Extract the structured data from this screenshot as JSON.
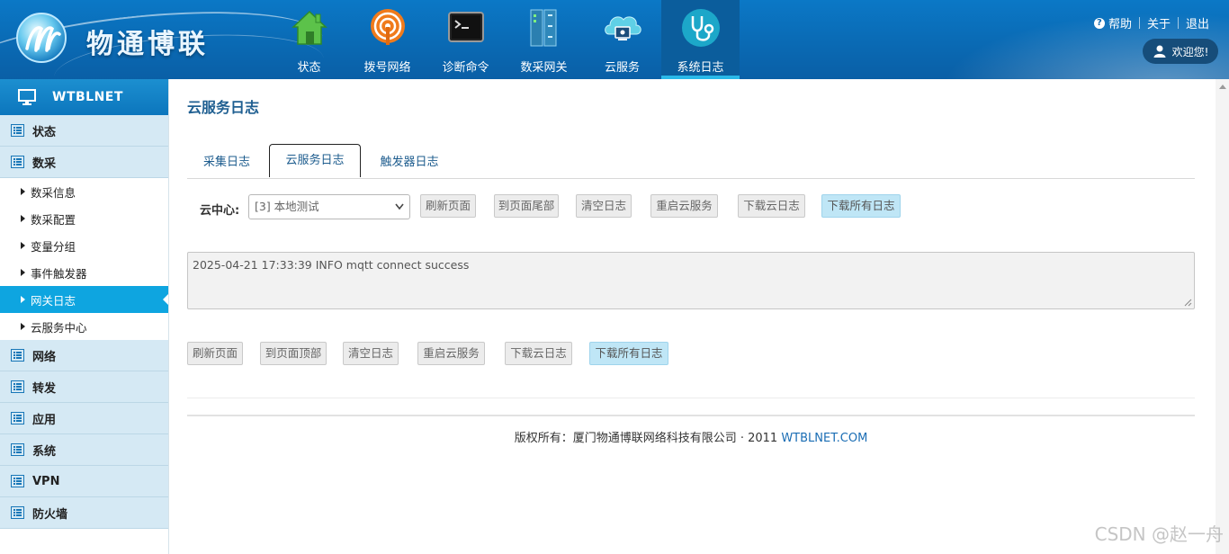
{
  "header": {
    "logo_text": "物通博联",
    "nav": [
      {
        "label": "状态",
        "icon": "home-icon"
      },
      {
        "label": "拨号网络",
        "icon": "dial-network-icon"
      },
      {
        "label": "诊断命令",
        "icon": "terminal-icon"
      },
      {
        "label": "数采网关",
        "icon": "gateway-icon"
      },
      {
        "label": "云服务",
        "icon": "cloud-service-icon"
      },
      {
        "label": "系统日志",
        "icon": "stethoscope-icon",
        "active": true
      }
    ],
    "help": "帮助",
    "about": "关于",
    "logout": "退出",
    "welcome": "欢迎您!"
  },
  "sidebar": {
    "brand": "WTBLNET",
    "sections": {
      "status": "状态",
      "data_acquisition": "数采",
      "network": "网络",
      "forward": "转发",
      "application": "应用",
      "system": "系统",
      "vpn": "VPN",
      "firewall": "防火墙"
    },
    "sub_items": [
      "数采信息",
      "数采配置",
      "变量分组",
      "事件触发器",
      "网关日志",
      "云服务中心"
    ],
    "active_sub": "网关日志"
  },
  "main": {
    "title": "云服务日志",
    "tabs": [
      "采集日志",
      "云服务日志",
      "触发器日志"
    ],
    "active_tab": "云服务日志",
    "cloud_center_label": "云中心:",
    "cloud_center_value": "[3]  本地测试",
    "buttons_top": [
      "刷新页面",
      "到页面尾部",
      "清空日志",
      "重启云服务",
      "下载云日志",
      "下载所有日志"
    ],
    "log_text": "2025-04-21 17:33:39 INFO mqtt connect success",
    "buttons_bottom": [
      "刷新页面",
      "到页面顶部",
      "清空日志",
      "重启云服务",
      "下载云日志",
      "下载所有日志"
    ]
  },
  "footer": {
    "copyright": "版权所有：厦门物通博联网络科技有限公司 · 2011",
    "link": "WTBLNET.COM"
  },
  "watermark": "CSDN @赵一舟"
}
